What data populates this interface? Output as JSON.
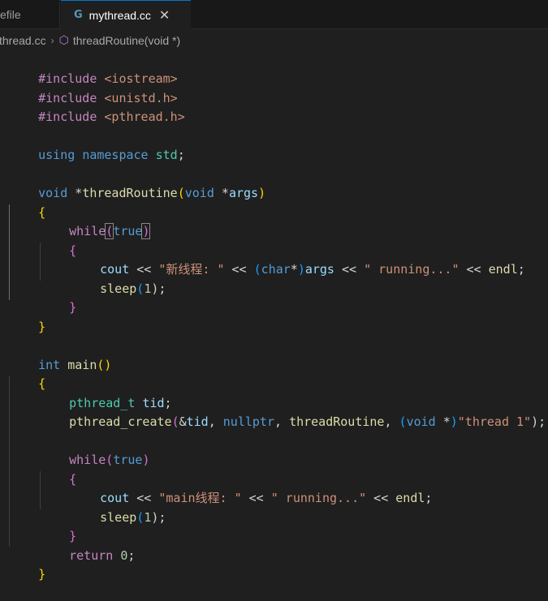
{
  "tabs": [
    {
      "label": "efile"
    },
    {
      "label": "mythread.cc",
      "icon": "cpp-file-icon",
      "close": "✕"
    }
  ],
  "breadcrumb": {
    "file": "thread.cc",
    "separator": "›",
    "symbol_icon": "cube-icon",
    "symbol": "threadRoutine(void *)"
  },
  "code": {
    "l1": [
      "#include",
      " ",
      "<iostream>"
    ],
    "l2": [
      "#include",
      " ",
      "<unistd.h>"
    ],
    "l3": [
      "#include",
      " ",
      "<pthread.h>"
    ],
    "l5": [
      "using",
      " ",
      "namespace",
      " ",
      "std",
      ";"
    ],
    "l7": [
      "void",
      " *",
      "threadRoutine",
      "(",
      "void",
      " *",
      "args",
      ")"
    ],
    "l8": [
      "{"
    ],
    "l9": [
      "while",
      "(",
      "true",
      ")"
    ],
    "l10": [
      "{"
    ],
    "l11": [
      "cout",
      " << ",
      "\"新线程: \"",
      " << ",
      "(",
      "char",
      "*",
      ")",
      "args",
      " << ",
      "\" running...\"",
      " << ",
      "endl",
      ";"
    ],
    "l12": [
      "sleep",
      "(",
      "1",
      ");"
    ],
    "l13": [
      "}"
    ],
    "l14": [
      "}"
    ],
    "l16": [
      "int",
      " ",
      "main",
      "()"
    ],
    "l17": [
      "{"
    ],
    "l18": [
      "pthread_t",
      " ",
      "tid",
      ";"
    ],
    "l19": [
      "pthread_create",
      "(",
      "&",
      "tid",
      ", ",
      "nullptr",
      ", ",
      "threadRoutine",
      ", ",
      "(",
      "void",
      " *",
      ")",
      "\"thread 1\"",
      ");"
    ],
    "l21": [
      "while",
      "(",
      "true",
      ")"
    ],
    "l22": [
      "{"
    ],
    "l23": [
      "cout",
      " << ",
      "\"main线程: \"",
      " << ",
      "\" running...\"",
      " << ",
      "endl",
      ";"
    ],
    "l24": [
      "sleep",
      "(",
      "1",
      ");"
    ],
    "l25": [
      "}"
    ],
    "l26": [
      "return",
      " ",
      "0",
      ";"
    ],
    "l27": [
      "}"
    ]
  },
  "colors": {
    "background": "#1f1f1f",
    "keyword": "#569cd6",
    "control": "#c586c0",
    "string": "#ce9178",
    "function": "#dcdcaa",
    "variable": "#9cdcfe",
    "type": "#4ec9b0",
    "number": "#b5cea8",
    "active_tab_border": "#0078d4"
  }
}
